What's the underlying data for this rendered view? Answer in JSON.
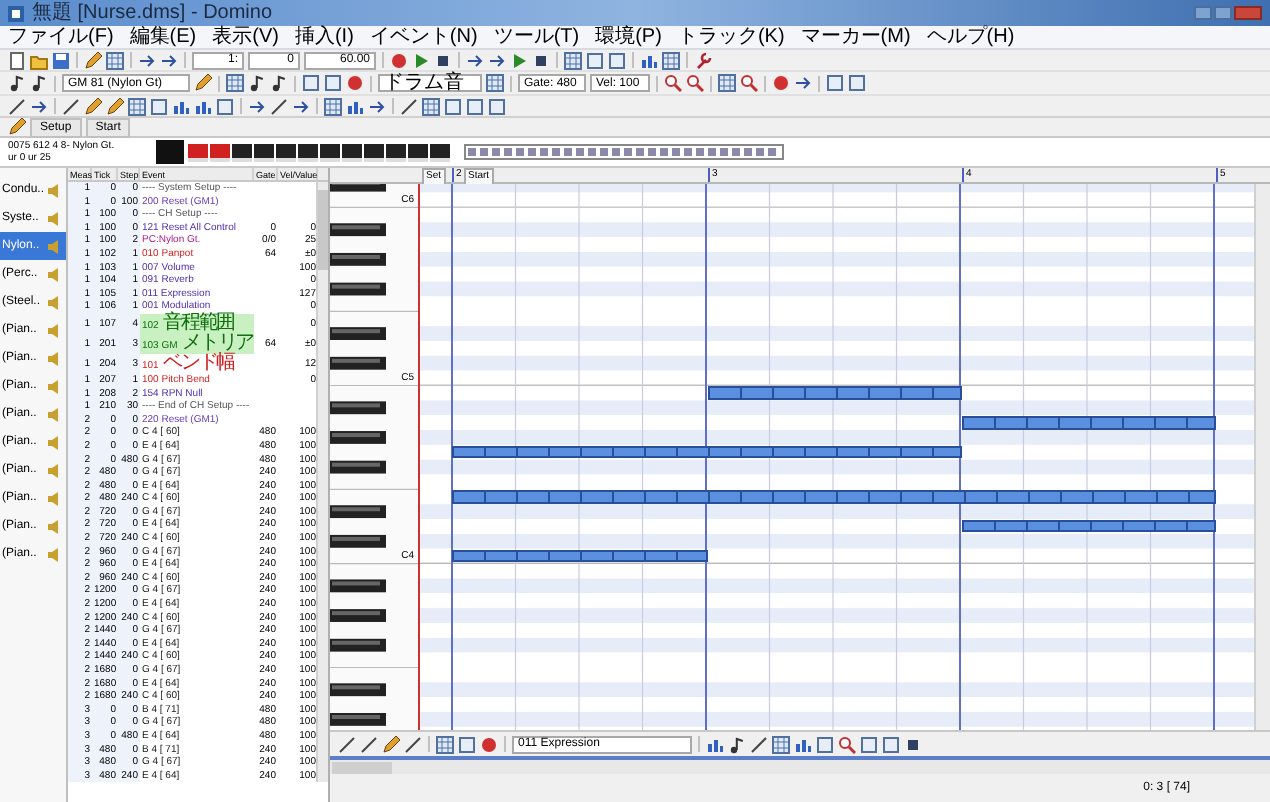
{
  "window": {
    "title": "無題 [Nurse.dms] - Domino"
  },
  "menu": [
    "ファイル(F)",
    "編集(E)",
    "表示(V)",
    "挿入(I)",
    "イベント(N)",
    "ツール(T)",
    "環境(P)",
    "トラック(K)",
    "マーカー(M)",
    "ヘルプ(H)"
  ],
  "toolbar": {
    "position_measure": "1:",
    "position_tick": "0",
    "tempo": "60.00",
    "instrument": "GM 81 (Nylon Gt)",
    "drum_map": "ドラム音",
    "gate": "Gate: 480",
    "velocity": "Vel: 100"
  },
  "tabs": [
    {
      "label": "Setup",
      "selected": false
    },
    {
      "label": "Start",
      "selected": false
    }
  ],
  "track_info": {
    "line_1": "0075 612 4 8- Nylon Gt.",
    "line_2": "ur  0  ur  25"
  },
  "tracks": [
    {
      "label": "Condu..",
      "selected": false
    },
    {
      "label": "Syste..",
      "selected": false
    },
    {
      "label": "Nylon..",
      "selected": true
    },
    {
      "label": "(Perc..",
      "selected": false
    },
    {
      "label": "(Steel..",
      "selected": false
    },
    {
      "label": "(Pian..",
      "selected": false
    },
    {
      "label": "(Pian..",
      "selected": false
    },
    {
      "label": "(Pian..",
      "selected": false
    },
    {
      "label": "(Pian..",
      "selected": false
    },
    {
      "label": "(Pian..",
      "selected": false
    },
    {
      "label": "(Pian..",
      "selected": false
    },
    {
      "label": "(Pian..",
      "selected": false
    },
    {
      "label": "(Pian..",
      "selected": false
    },
    {
      "label": "(Pian..",
      "selected": false
    }
  ],
  "event_columns": [
    "Meas",
    "Tick",
    "Step",
    "Event",
    "Gate",
    "Vel/Value"
  ],
  "events": [
    {
      "meas": "1",
      "tick": "0",
      "step": "0",
      "event": "---- System Setup ----",
      "kind": "section"
    },
    {
      "meas": "1",
      "tick": "0",
      "step": "100",
      "event": "200 Reset (GM1)",
      "kind": "sysex"
    },
    {
      "meas": "1",
      "tick": "100",
      "step": "0",
      "event": "---- CH Setup ----",
      "kind": "section"
    },
    {
      "meas": "1",
      "tick": "100",
      "step": "0",
      "event": "121 Reset All Control",
      "gate": "0",
      "value": "0",
      "kind": "control"
    },
    {
      "meas": "1",
      "tick": "100",
      "step": "2",
      "event": "PC:Nylon Gt.",
      "gate": "0/0",
      "value": "25",
      "kind": "program"
    },
    {
      "meas": "1",
      "tick": "102",
      "step": "1",
      "event": "010 Panpot",
      "gate": "64",
      "value": "±0",
      "kind": "pitch"
    },
    {
      "meas": "1",
      "tick": "103",
      "step": "1",
      "event": "007 Volume",
      "value": "100",
      "kind": "control"
    },
    {
      "meas": "1",
      "tick": "104",
      "step": "1",
      "event": "091 Reverb",
      "value": "0",
      "kind": "control"
    },
    {
      "meas": "1",
      "tick": "105",
      "step": "1",
      "event": "011 Expression",
      "value": "127",
      "kind": "control"
    },
    {
      "meas": "1",
      "tick": "106",
      "step": "1",
      "event": "001 Modulation",
      "value": "0",
      "kind": "control"
    },
    {
      "meas": "1",
      "tick": "107",
      "step": "4",
      "event": "102 音程範囲",
      "value": "0",
      "kind": "rpn"
    },
    {
      "meas": "1",
      "tick": "201",
      "step": "3",
      "event": "103 GM メトリア",
      "gate": "64",
      "value": "±0",
      "kind": "rpn"
    },
    {
      "meas": "1",
      "tick": "204",
      "step": "3",
      "event": "101 ベンド幅",
      "value": "12",
      "kind": "pitch"
    },
    {
      "meas": "1",
      "tick": "207",
      "step": "1",
      "event": "100 Pitch Bend",
      "value": "0",
      "kind": "pitch"
    },
    {
      "meas": "1",
      "tick": "208",
      "step": "2",
      "event": "154 RPN Null",
      "kind": "control"
    },
    {
      "meas": "1",
      "tick": "210",
      "step": "30",
      "event": "---- End of CH Setup ----",
      "kind": "section"
    },
    {
      "meas": "2",
      "tick": "0",
      "step": "0",
      "event": "220 Reset (GM1)",
      "kind": "sysex"
    },
    {
      "meas": "2",
      "tick": "0",
      "step": "0",
      "event": "C  4 [ 60]",
      "gate": "480",
      "value": "100",
      "kind": "note"
    },
    {
      "meas": "2",
      "tick": "0",
      "step": "0",
      "event": "E  4 [ 64]",
      "gate": "480",
      "value": "100",
      "kind": "note"
    },
    {
      "meas": "2",
      "tick": "0",
      "step": "480",
      "event": "G  4 [ 67]",
      "gate": "480",
      "value": "100",
      "kind": "note"
    },
    {
      "meas": "2",
      "tick": "480",
      "step": "0",
      "event": "G  4 [ 67]",
      "gate": "240",
      "value": "100",
      "kind": "note"
    },
    {
      "meas": "2",
      "tick": "480",
      "step": "0",
      "event": "E  4 [ 64]",
      "gate": "240",
      "value": "100",
      "kind": "note"
    },
    {
      "meas": "2",
      "tick": "480",
      "step": "240",
      "event": "C  4 [ 60]",
      "gate": "240",
      "value": "100",
      "kind": "note"
    },
    {
      "meas": "2",
      "tick": "720",
      "step": "0",
      "event": "G  4 [ 67]",
      "gate": "240",
      "value": "100",
      "kind": "note"
    },
    {
      "meas": "2",
      "tick": "720",
      "step": "0",
      "event": "E  4 [ 64]",
      "gate": "240",
      "value": "100",
      "kind": "note"
    },
    {
      "meas": "2",
      "tick": "720",
      "step": "240",
      "event": "C  4 [ 60]",
      "gate": "240",
      "value": "100",
      "kind": "note"
    },
    {
      "meas": "2",
      "tick": "960",
      "step": "0",
      "event": "G  4 [ 67]",
      "gate": "240",
      "value": "100",
      "kind": "note"
    },
    {
      "meas": "2",
      "tick": "960",
      "step": "0",
      "event": "E  4 [ 64]",
      "gate": "240",
      "value": "100",
      "kind": "note"
    },
    {
      "meas": "2",
      "tick": "960",
      "step": "240",
      "event": "C  4 [ 60]",
      "gate": "240",
      "value": "100",
      "kind": "note"
    },
    {
      "meas": "2",
      "tick": "1200",
      "step": "0",
      "event": "G  4 [ 67]",
      "gate": "240",
      "value": "100",
      "kind": "note"
    },
    {
      "meas": "2",
      "tick": "1200",
      "step": "0",
      "event": "E  4 [ 64]",
      "gate": "240",
      "value": "100",
      "kind": "note"
    },
    {
      "meas": "2",
      "tick": "1200",
      "step": "240",
      "event": "C  4 [ 60]",
      "gate": "240",
      "value": "100",
      "kind": "note"
    },
    {
      "meas": "2",
      "tick": "1440",
      "step": "0",
      "event": "G  4 [ 67]",
      "gate": "240",
      "value": "100",
      "kind": "note"
    },
    {
      "meas": "2",
      "tick": "1440",
      "step": "0",
      "event": "E  4 [ 64]",
      "gate": "240",
      "value": "100",
      "kind": "note"
    },
    {
      "meas": "2",
      "tick": "1440",
      "step": "240",
      "event": "C  4 [ 60]",
      "gate": "240",
      "value": "100",
      "kind": "note"
    },
    {
      "meas": "2",
      "tick": "1680",
      "step": "0",
      "event": "G  4 [ 67]",
      "gate": "240",
      "value": "100",
      "kind": "note"
    },
    {
      "meas": "2",
      "tick": "1680",
      "step": "0",
      "event": "E  4 [ 64]",
      "gate": "240",
      "value": "100",
      "kind": "note"
    },
    {
      "meas": "2",
      "tick": "1680",
      "step": "240",
      "event": "C  4 [ 60]",
      "gate": "240",
      "value": "100",
      "kind": "note"
    },
    {
      "meas": "3",
      "tick": "0",
      "step": "0",
      "event": "B  4 [ 71]",
      "gate": "480",
      "value": "100",
      "kind": "note"
    },
    {
      "meas": "3",
      "tick": "0",
      "step": "0",
      "event": "G  4 [ 67]",
      "gate": "480",
      "value": "100",
      "kind": "note"
    },
    {
      "meas": "3",
      "tick": "0",
      "step": "480",
      "event": "E  4 [ 64]",
      "gate": "480",
      "value": "100",
      "kind": "note"
    },
    {
      "meas": "3",
      "tick": "480",
      "step": "0",
      "event": "B  4 [ 71]",
      "gate": "240",
      "value": "100",
      "kind": "note"
    },
    {
      "meas": "3",
      "tick": "480",
      "step": "0",
      "event": "G  4 [ 67]",
      "gate": "240",
      "value": "100",
      "kind": "note"
    },
    {
      "meas": "3",
      "tick": "480",
      "step": "240",
      "event": "E  4 [ 64]",
      "gate": "240",
      "value": "100",
      "kind": "note"
    }
  ],
  "keyboard": {
    "octave_labels": [
      "C6",
      "C5",
      "C4"
    ]
  },
  "ruler": {
    "markers": [
      "Set",
      "Start"
    ],
    "measures": [
      "2",
      "3",
      "4",
      "5"
    ]
  },
  "controller": {
    "selected": "011 Expression"
  },
  "status_bar": {
    "position": "0: 3 [ 74]"
  }
}
